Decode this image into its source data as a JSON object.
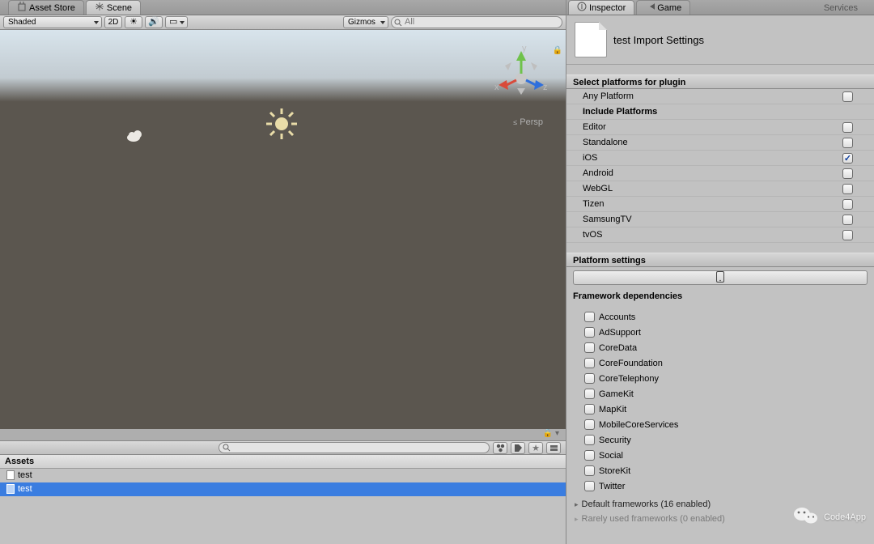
{
  "tabs_left": {
    "asset_store": "Asset Store",
    "scene": "Scene"
  },
  "tabs_right": {
    "inspector": "Inspector",
    "game": "Game",
    "services": "Services"
  },
  "scene_toolbar": {
    "shading": "Shaded",
    "mode2d": "2D",
    "gizmos": "Gizmos",
    "search_placeholder": "All"
  },
  "viewport": {
    "axis_x": "x",
    "axis_y": "y",
    "axis_z": "z",
    "persp": "Persp"
  },
  "project": {
    "search_placeholder": "",
    "assets_label": "Assets",
    "items": [
      {
        "name": "test",
        "selected": false
      },
      {
        "name": "test",
        "selected": true
      }
    ]
  },
  "inspector": {
    "title": "test Import Settings",
    "section_select": "Select platforms for plugin",
    "include_label": "Include Platforms",
    "platforms": [
      {
        "name": "Any Platform",
        "checked": false
      },
      {
        "name": "Editor",
        "checked": false
      },
      {
        "name": "Standalone",
        "checked": false
      },
      {
        "name": "iOS",
        "checked": true
      },
      {
        "name": "Android",
        "checked": false
      },
      {
        "name": "WebGL",
        "checked": false
      },
      {
        "name": "Tizen",
        "checked": false
      },
      {
        "name": "SamsungTV",
        "checked": false
      },
      {
        "name": "tvOS",
        "checked": false
      }
    ],
    "platform_settings": "Platform settings",
    "framework_title": "Framework dependencies",
    "frameworks": [
      "Accounts",
      "AdSupport",
      "CoreData",
      "CoreFoundation",
      "CoreTelephony",
      "GameKit",
      "MapKit",
      "MobileCoreServices",
      "Security",
      "Social",
      "StoreKit",
      "Twitter"
    ],
    "default_fw": "Default frameworks (16 enabled)",
    "rarely_fw": "Rarely used frameworks (0 enabled)"
  },
  "watermark": "Code4App"
}
